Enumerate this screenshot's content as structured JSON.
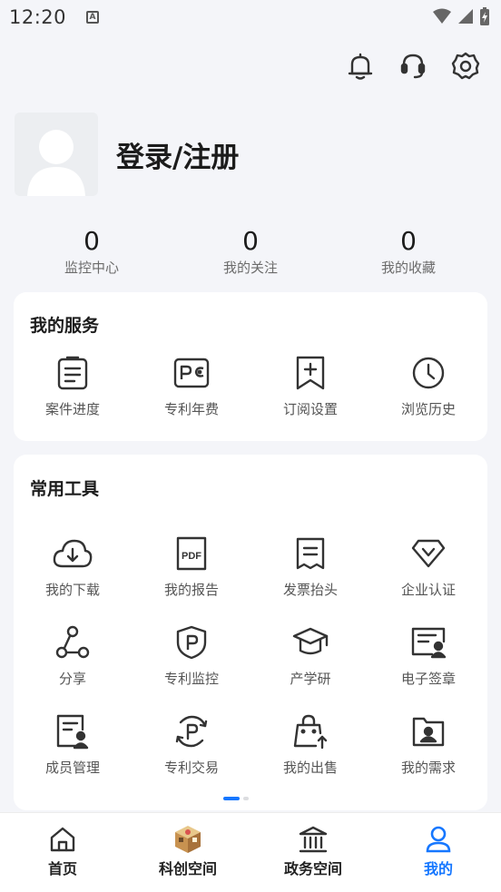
{
  "status_bar": {
    "time": "12:20",
    "notification_icon": "A"
  },
  "profile": {
    "login_label": "登录/注册"
  },
  "stats": [
    {
      "value": "0",
      "label": "监控中心"
    },
    {
      "value": "0",
      "label": "我的关注"
    },
    {
      "value": "0",
      "label": "我的收藏"
    }
  ],
  "services": {
    "title": "我的服务",
    "items": [
      {
        "label": "案件进度",
        "icon": "clipboard-list-icon"
      },
      {
        "label": "专利年费",
        "icon": "patent-fee-icon"
      },
      {
        "label": "订阅设置",
        "icon": "bookmark-plus-icon"
      },
      {
        "label": "浏览历史",
        "icon": "clock-icon"
      }
    ]
  },
  "tools": {
    "title": "常用工具",
    "items": [
      {
        "label": "我的下载",
        "icon": "cloud-download-icon"
      },
      {
        "label": "我的报告",
        "icon": "pdf-file-icon"
      },
      {
        "label": "发票抬头",
        "icon": "invoice-icon"
      },
      {
        "label": "企业认证",
        "icon": "verified-badge-icon"
      },
      {
        "label": "分享",
        "icon": "share-icon"
      },
      {
        "label": "专利监控",
        "icon": "patent-shield-icon"
      },
      {
        "label": "产学研",
        "icon": "graduation-cap-icon"
      },
      {
        "label": "电子签章",
        "icon": "e-signature-icon"
      },
      {
        "label": "成员管理",
        "icon": "member-doc-icon"
      },
      {
        "label": "专利交易",
        "icon": "patent-trade-icon"
      },
      {
        "label": "我的出售",
        "icon": "sell-bag-icon"
      },
      {
        "label": "我的需求",
        "icon": "demand-folder-icon"
      }
    ]
  },
  "bottom_nav": [
    {
      "label": "首页",
      "icon": "home-icon"
    },
    {
      "label": "科创空间",
      "icon": "innovation-space-icon"
    },
    {
      "label": "政务空间",
      "icon": "government-building-icon"
    },
    {
      "label": "我的",
      "icon": "user-icon",
      "active": true
    }
  ],
  "colors": {
    "accent": "#1677ff",
    "background": "#f4f5f9",
    "icon_stroke": "#333333"
  }
}
